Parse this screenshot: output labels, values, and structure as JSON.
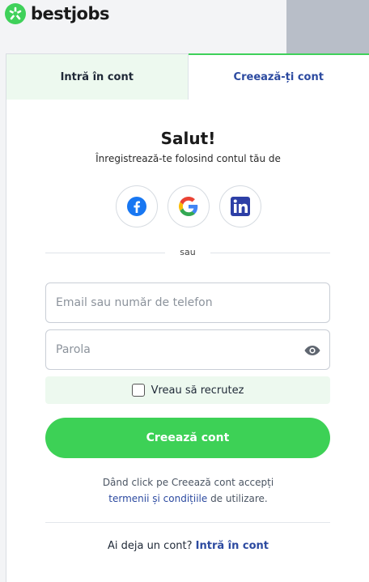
{
  "brand": {
    "name": "bestjobs",
    "color": "#3fd15a"
  },
  "tabs": {
    "login": "Intră în cont",
    "register": "Creează-ți cont"
  },
  "form": {
    "title": "Salut!",
    "subtitle": "Înregistrează-te folosind contul tău de",
    "socials": [
      {
        "name": "facebook",
        "icon": "facebook-icon"
      },
      {
        "name": "google",
        "icon": "google-icon"
      },
      {
        "name": "linkedin",
        "icon": "linkedin-icon"
      }
    ],
    "separator": "sau",
    "email": {
      "value": "",
      "placeholder": "Email sau număr de telefon"
    },
    "password": {
      "value": "",
      "placeholder": "Parola"
    },
    "recruit_label": "Vreau să recrutez",
    "recruit_checked": false,
    "submit": "Creează cont",
    "terms_prefix": "Dând click pe Creează cont accepți",
    "terms_link": "termenii și condițiile",
    "terms_suffix": " de utilizare.",
    "have_account": "Ai deja un cont?",
    "login_link": "Intră în cont"
  },
  "colors": {
    "accent": "#3dd156",
    "link": "#2c4aa0",
    "tab_active_bg": "#edf9ef"
  }
}
